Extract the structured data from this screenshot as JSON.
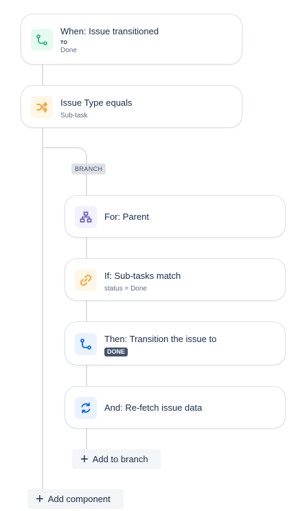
{
  "trigger": {
    "title": "When: Issue transitioned",
    "label": "TO",
    "value": "Done",
    "icon": "transition-icon",
    "icon_color": "#36b37e",
    "icon_bg": "#e3fcef"
  },
  "condition": {
    "title": "Issue Type equals",
    "value": "Sub-task",
    "icon": "shuffle-icon",
    "icon_color": "#ff991f",
    "icon_bg": "#fff7e6"
  },
  "branch": {
    "tag": "BRANCH",
    "for": {
      "title": "For: Parent",
      "icon": "hierarchy-icon",
      "icon_color": "#6554c0",
      "icon_bg": "#f3f0ff"
    },
    "if": {
      "title": "If: Sub-tasks match",
      "value": "status = Done",
      "icon": "link-icon",
      "icon_color": "#ff991f",
      "icon_bg": "#fff7e6"
    },
    "then": {
      "title": "Then: Transition the issue to",
      "status": "DONE",
      "icon": "transition-icon",
      "icon_color": "#0065ff",
      "icon_bg": "#e9f2ff"
    },
    "and": {
      "title": "And: Re-fetch issue data",
      "icon": "refresh-icon",
      "icon_color": "#0065ff",
      "icon_bg": "#e9f2ff"
    },
    "add_label": "Add to branch"
  },
  "add_component_label": "Add component"
}
